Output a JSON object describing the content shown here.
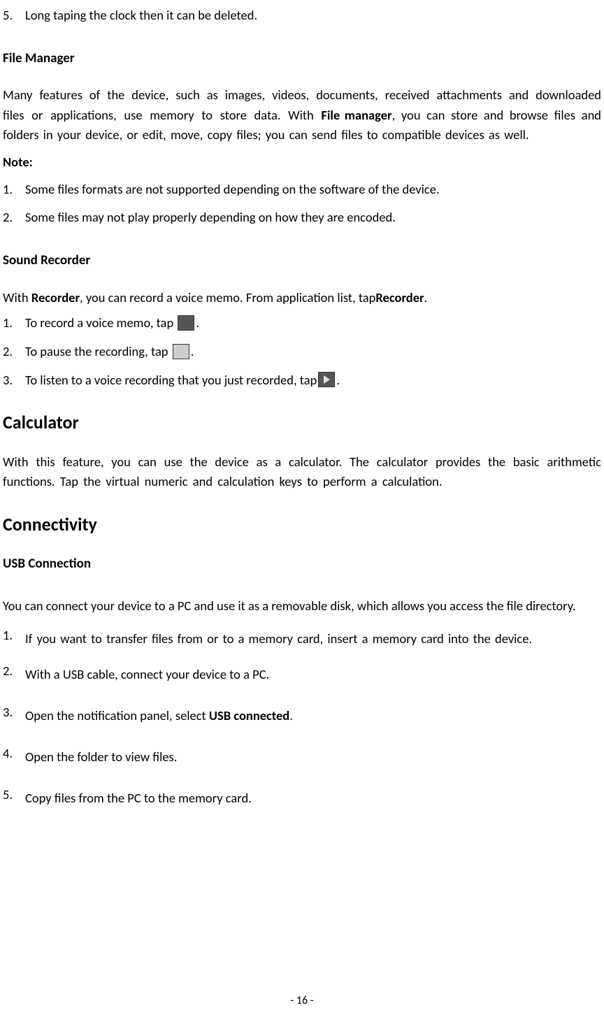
{
  "topItem": {
    "num": "5.",
    "text": "Long taping the clock then it can be deleted."
  },
  "fileManager": {
    "heading": "File Manager",
    "para1_a": "Many features of the device, such as images, videos, documents, received attachments and downloaded files or applications, use memory to store data. With ",
    "para1_bold": "File manager",
    "para1_b": ", you can store and browse files and folders in your device, or edit, move, copy files; you can send files to compatible devices as well.",
    "noteLabel": "Note:",
    "note1": {
      "num": "1.",
      "text": "Some files formats are not supported depending on the software of the device."
    },
    "note2": {
      "num": "2.",
      "text": "Some files may not play properly depending on how they are encoded."
    }
  },
  "soundRecorder": {
    "heading": "Sound Recorder",
    "intro_a": "With ",
    "intro_bold1": "Recorder",
    "intro_b": ", you can record a voice memo. From application list, tap",
    "intro_bold2": "Recorder",
    "intro_c": ".",
    "item1": {
      "num": "1.",
      "text": "To record a voice memo, tap "
    },
    "item2": {
      "num": "2.",
      "text": "To pause the recording, tap "
    },
    "item3": {
      "num": "3.",
      "text": "To listen to a voice recording that you just recorded, tap"
    }
  },
  "calculator": {
    "heading": "Calculator",
    "para": "With this feature, you can use the device as a calculator. The calculator provides the basic arithmetic functions. Tap the virtual numeric and calculation keys to perform a calculation."
  },
  "connectivity": {
    "heading": "Connectivity",
    "sub": "USB Connection",
    "intro": "You can connect your device to a PC and use it as a removable disk, which allows you access the file directory.",
    "item1": {
      "num": "1.",
      "text": "If you want to transfer files from or to a memory card, insert a memory card into the device."
    },
    "item2": {
      "num": "2.",
      "text": "With a USB cable, connect your device to a PC."
    },
    "item3": {
      "num": "3.",
      "text_a": "Open the notification panel, select ",
      "bold": "USB connected",
      "text_b": "."
    },
    "item4": {
      "num": "4.",
      "text": "Open the folder to view files."
    },
    "item5": {
      "num": "5.",
      "text": "Copy files from the PC to the memory card."
    }
  },
  "pageNum": "- 16 -"
}
